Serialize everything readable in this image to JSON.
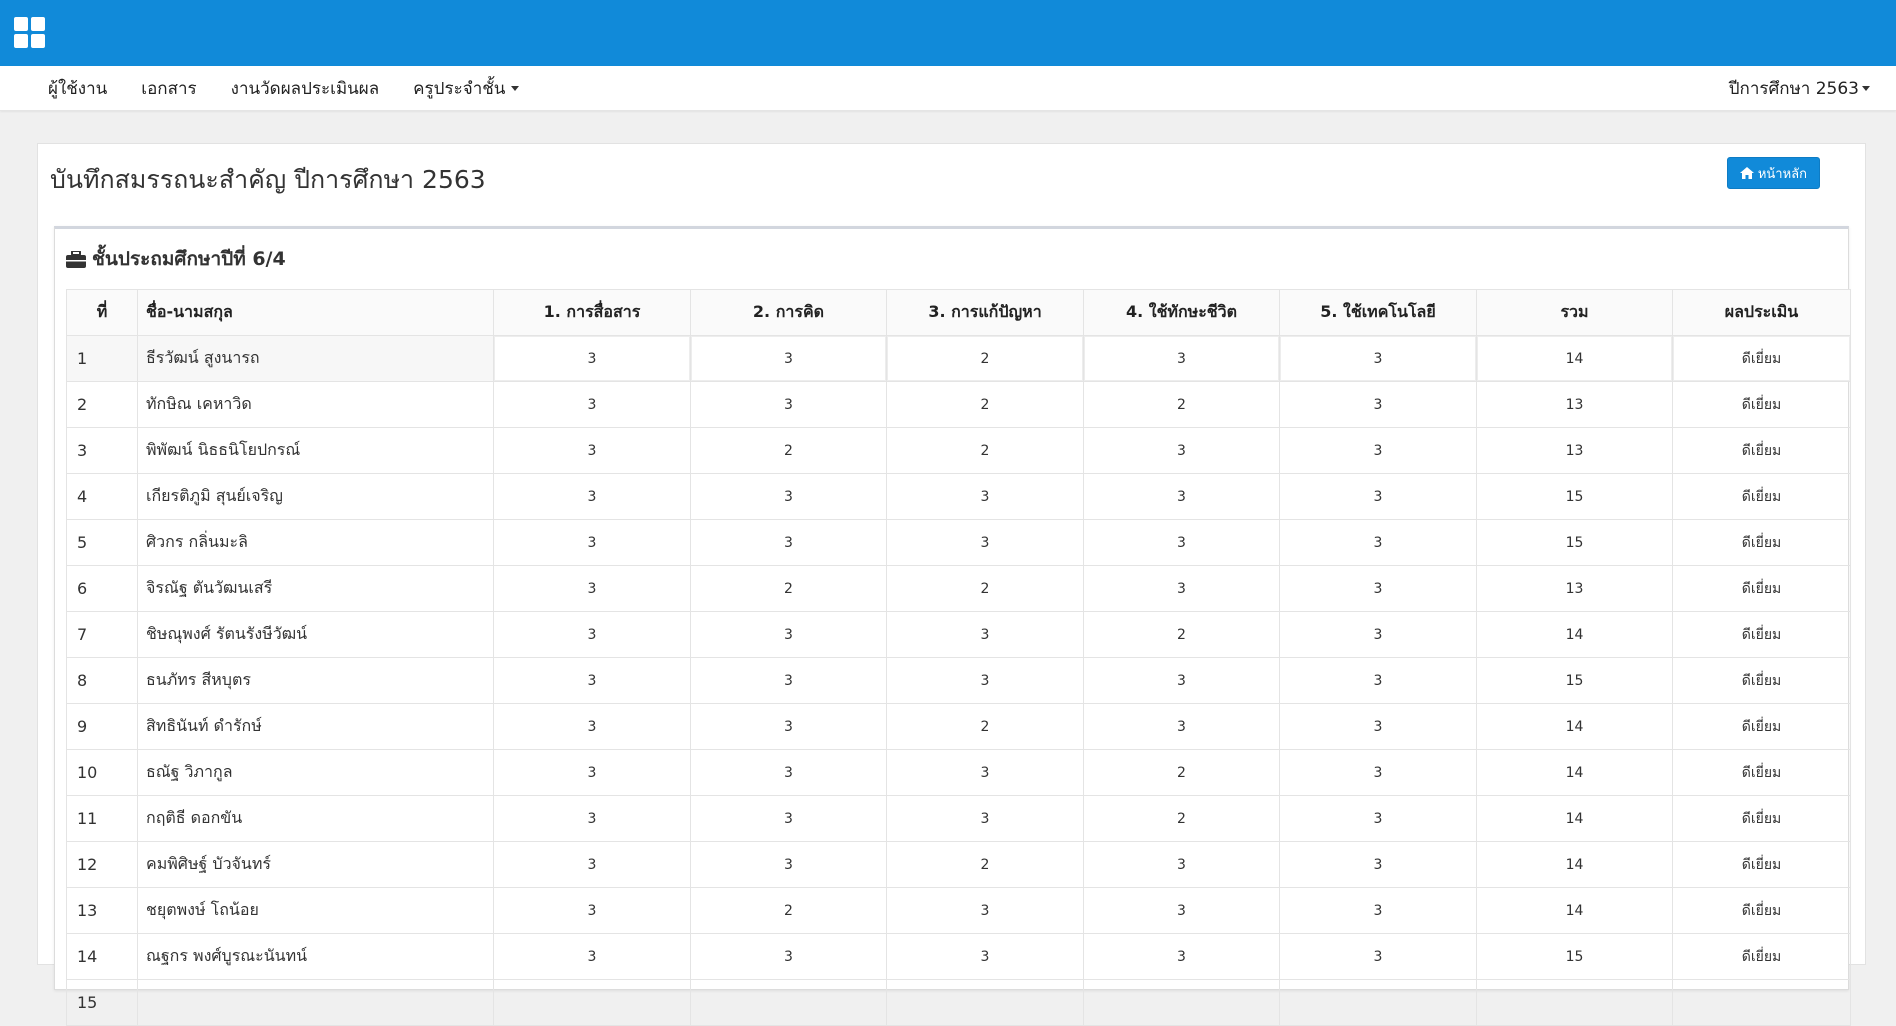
{
  "navbar": {
    "items": [
      {
        "label": "ผู้ใช้งาน"
      },
      {
        "label": "เอกสาร"
      },
      {
        "label": "งานวัดผลประเมินผล"
      },
      {
        "label": "ครูประจำชั้น"
      }
    ],
    "year_label": "ปีการศึกษา 2563"
  },
  "page": {
    "title": "บันทึกสมรรถนะสำคัญ ปีการศึกษา 2563",
    "home_button": "หน้าหลัก"
  },
  "section": {
    "title": "ชั้นประถมศึกษาปีที่ 6/4"
  },
  "table": {
    "headers": [
      "ที่",
      "ชื่อ-นามสกุล",
      "1. การสื่อสาร",
      "2. การคิด",
      "3. การแก้ปัญหา",
      "4. ใช้ทักษะชีวิต",
      "5. ใช้เทคโนโลยี",
      "รวม",
      "ผลประเมิน"
    ],
    "rows": [
      [
        "1",
        "ธีรวัฒน์ สูงนารถ",
        "3",
        "3",
        "2",
        "3",
        "3",
        "14",
        "ดีเยี่ยม"
      ],
      [
        "2",
        "ทักษิณ เคหาวิด",
        "3",
        "3",
        "2",
        "2",
        "3",
        "13",
        "ดีเยี่ยม"
      ],
      [
        "3",
        "พิพัฒน์ นิธธนิโยปกรณ์",
        "3",
        "2",
        "2",
        "3",
        "3",
        "13",
        "ดีเยี่ยม"
      ],
      [
        "4",
        "เกียรติภูมิ สุนย์เจริญ",
        "3",
        "3",
        "3",
        "3",
        "3",
        "15",
        "ดีเยี่ยม"
      ],
      [
        "5",
        "ศิวกร กลิ่นมะลิ",
        "3",
        "3",
        "3",
        "3",
        "3",
        "15",
        "ดีเยี่ยม"
      ],
      [
        "6",
        "จิรณัฐ ตันวัฒนเสรี",
        "3",
        "2",
        "2",
        "3",
        "3",
        "13",
        "ดีเยี่ยม"
      ],
      [
        "7",
        "ชิษณุพงศ์ รัตนรังษีวัฒน์",
        "3",
        "3",
        "3",
        "2",
        "3",
        "14",
        "ดีเยี่ยม"
      ],
      [
        "8",
        "ธนภัทร สีหบุตร",
        "3",
        "3",
        "3",
        "3",
        "3",
        "15",
        "ดีเยี่ยม"
      ],
      [
        "9",
        "สิทธินันท์ ดำรักษ์",
        "3",
        "3",
        "2",
        "3",
        "3",
        "14",
        "ดีเยี่ยม"
      ],
      [
        "10",
        "ธณัฐ วิภากูล",
        "3",
        "3",
        "3",
        "2",
        "3",
        "14",
        "ดีเยี่ยม"
      ],
      [
        "11",
        "กฤติธี ดอกขัน",
        "3",
        "3",
        "3",
        "2",
        "3",
        "14",
        "ดีเยี่ยม"
      ],
      [
        "12",
        "คมพิศิษฐ์ บัวจันทร์",
        "3",
        "3",
        "2",
        "3",
        "3",
        "14",
        "ดีเยี่ยม"
      ],
      [
        "13",
        "ชยุตพงษ์ โถน้อย",
        "3",
        "2",
        "3",
        "3",
        "3",
        "14",
        "ดีเยี่ยม"
      ],
      [
        "14",
        "ณฐกร พงศ์บูรณะนันทน์",
        "3",
        "3",
        "3",
        "3",
        "3",
        "15",
        "ดีเยี่ยม"
      ],
      [
        "15",
        "",
        "",
        "",
        "",
        "",
        "",
        "",
        ""
      ]
    ]
  }
}
